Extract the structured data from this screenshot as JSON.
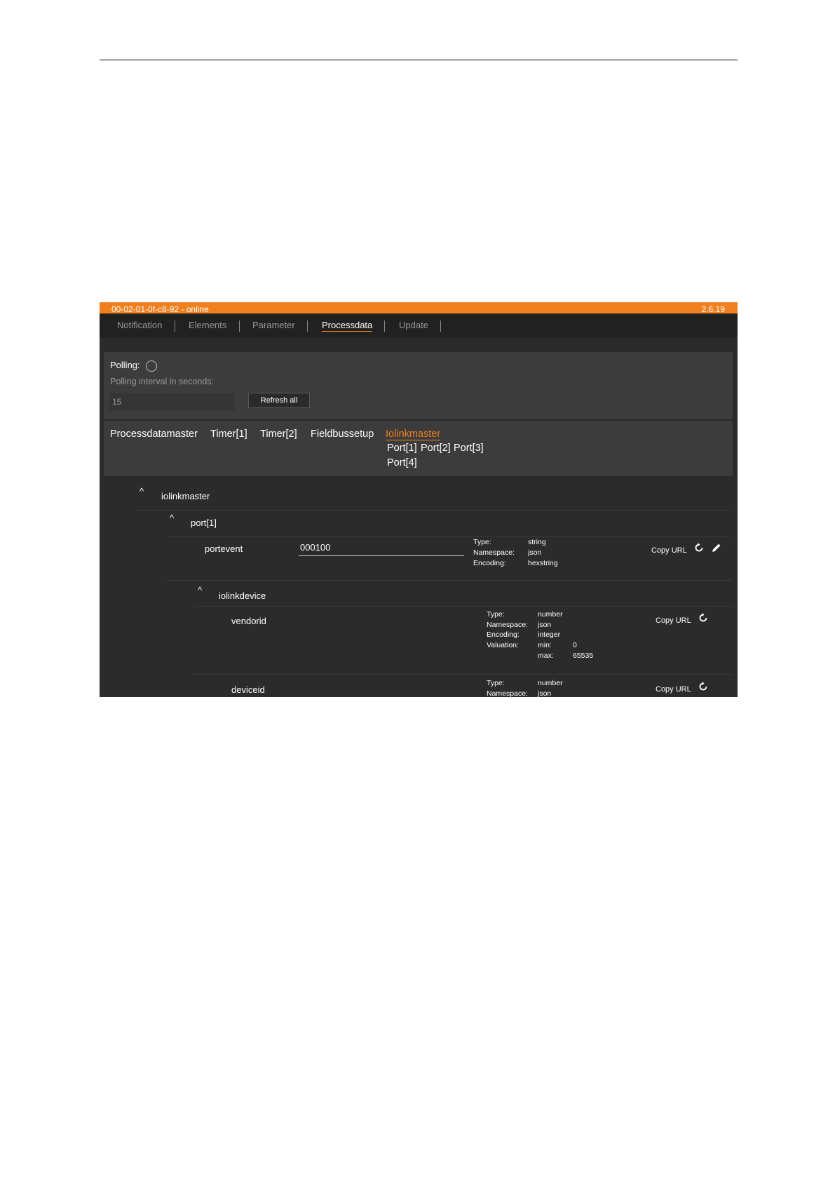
{
  "header": {
    "device": "00-02-01-0f-c8-92 - online",
    "version": "2.6.19"
  },
  "tabs": [
    {
      "label": "Notification",
      "active": false
    },
    {
      "label": "Elements",
      "active": false
    },
    {
      "label": "Parameter",
      "active": false
    },
    {
      "label": "Processdata",
      "active": true
    },
    {
      "label": "Update",
      "active": false
    }
  ],
  "polling": {
    "label": "Polling:",
    "enabled": false,
    "interval_label": "Polling interval in seconds:",
    "interval_value": "15",
    "refresh_label": "Refresh all"
  },
  "groups": [
    {
      "label": "Processdatamaster"
    },
    {
      "label": "Timer[1]"
    },
    {
      "label": "Timer[2]"
    },
    {
      "label": "Fieldbussetup"
    },
    {
      "label": "Iolinkmaster",
      "active": true
    }
  ],
  "subgroups": [
    "Port[1]",
    "Port[2]",
    "Port[3]",
    "Port[4]"
  ],
  "tree": {
    "caret": "^",
    "root": "iolinkmaster",
    "port": "port[1]",
    "device": "iolinkdevice",
    "copy_url": "Copy URL",
    "items": [
      {
        "name": "portevent",
        "value": "000100",
        "meta": [
          {
            "key": "Type:",
            "value": "string"
          },
          {
            "key": "Namespace:",
            "value": "json"
          },
          {
            "key": "Encoding:",
            "value": "hexstring"
          }
        ]
      },
      {
        "name": "vendorid",
        "meta": [
          {
            "key": "Type:",
            "value": "number"
          },
          {
            "key": "Namespace:",
            "value": "json"
          },
          {
            "key": "Encoding:",
            "value": "integer"
          },
          {
            "key": "Valuation:",
            "value": "min:",
            "value2": "0"
          },
          {
            "key": "",
            "value": "max:",
            "value2": "65535"
          }
        ]
      },
      {
        "name": "deviceid",
        "meta": [
          {
            "key": "Type:",
            "value": "number"
          },
          {
            "key": "Namespace:",
            "value": "json"
          }
        ]
      }
    ]
  },
  "colors": {
    "accent": "#f07f1e",
    "background": "#2b2b2b",
    "panel": "#3c3c3c"
  },
  "icons": [
    "refresh-icon",
    "edit-pencil-icon"
  ]
}
